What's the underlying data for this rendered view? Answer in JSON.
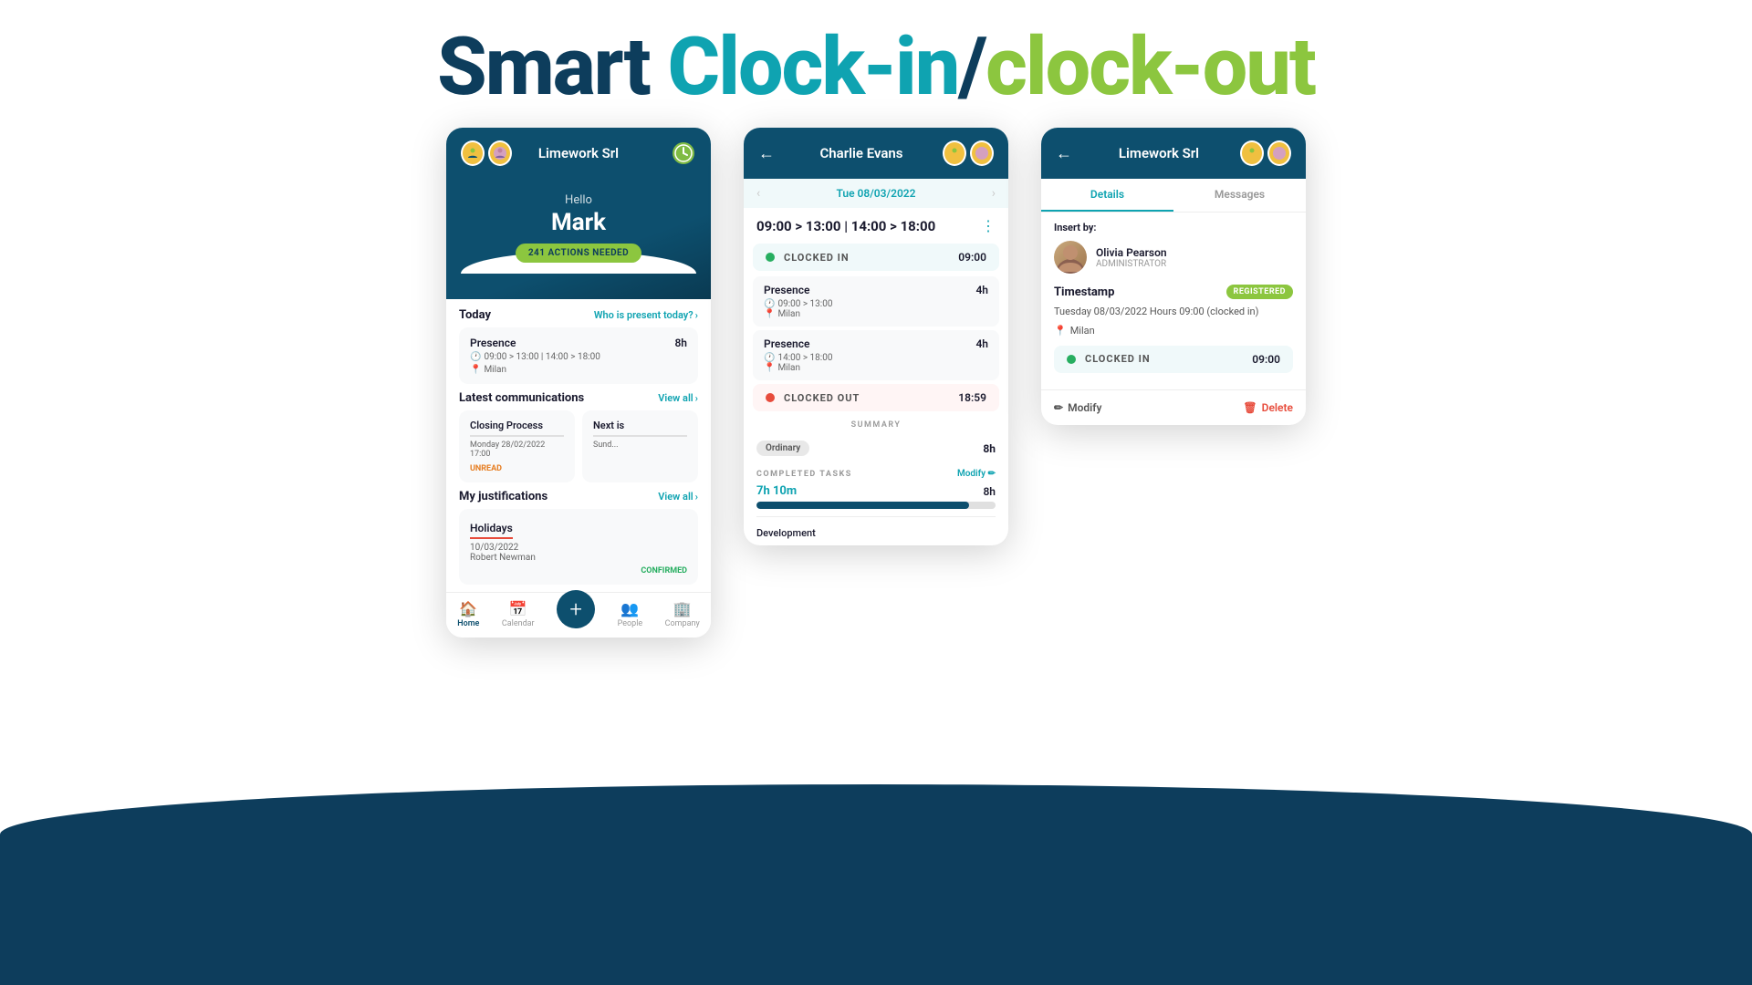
{
  "page": {
    "title_smart": "Smart ",
    "title_clock_in": "Clock-in",
    "title_slash": "/",
    "title_clock_out": "clock-out"
  },
  "phone1": {
    "header_title": "Limework Srl",
    "hello": "Hello",
    "name": "Mark",
    "actions_badge": "241 ACTIONS NEEDED",
    "today_label": "Today",
    "who_present": "Who is present today?",
    "presence_label": "Presence",
    "presence_hours": "8h",
    "presence_time": "09:00 > 13:00  |  14:00 > 18:00",
    "presence_location": "Milan",
    "latest_comm_label": "Latest communications",
    "view_all_1": "View all",
    "comm1_title": "Closing Process",
    "comm1_date": "Monday 28/02/2022 17:00",
    "comm1_status": "UNREAD",
    "comm2_title": "Next is",
    "comm2_date": "Sund...",
    "my_justif_label": "My justifications",
    "view_all_2": "View all",
    "justif_title": "Holidays",
    "justif_date": "10/03/2022",
    "justif_person": "Robert Newman",
    "justif_status": "CONFIRMED",
    "nav_home": "Home",
    "nav_calendar": "Calendar",
    "nav_people": "People",
    "nav_company": "Company"
  },
  "phone2": {
    "header_title": "Charlie Evans",
    "date": "Tue 08/03/2022",
    "time_range": "09:00 > 13:00  |  14:00 > 18:00",
    "clocked_in_status": "CLOCKED IN",
    "clocked_in_time": "09:00",
    "presence1_label": "Presence",
    "presence1_hours": "4h",
    "presence1_time": "09:00 > 13:00",
    "presence1_loc": "Milan",
    "presence2_label": "Presence",
    "presence2_hours": "4h",
    "presence2_time": "14:00 > 18:00",
    "presence2_loc": "Milan",
    "clocked_out_status": "CLOCKED OUT",
    "clocked_out_time": "18:59",
    "summary_label": "SUMMARY",
    "ordinary_label": "Ordinary",
    "ordinary_hours": "8h",
    "completed_tasks": "COMPLETED TASKS",
    "modify_label": "Modify",
    "progress_val": "7h 10m",
    "progress_max": "8h",
    "progress_pct": 89,
    "task_name": "Development"
  },
  "phone3": {
    "header_title": "Limework Srl",
    "tab_details": "Details",
    "tab_messages": "Messages",
    "insert_by_label": "Insert by:",
    "person_name": "Olivia Pearson",
    "person_role": "ADMINISTRATOR",
    "timestamp_label": "Timestamp",
    "registered_badge": "REGISTERED",
    "timestamp_desc": "Tuesday 08/03/2022 Hours 09:00 (clocked in)",
    "location": "Milan",
    "clocked_in_status": "CLOCKED IN",
    "clocked_in_time": "09:00",
    "modify_btn": "Modify",
    "delete_btn": "Delete"
  }
}
